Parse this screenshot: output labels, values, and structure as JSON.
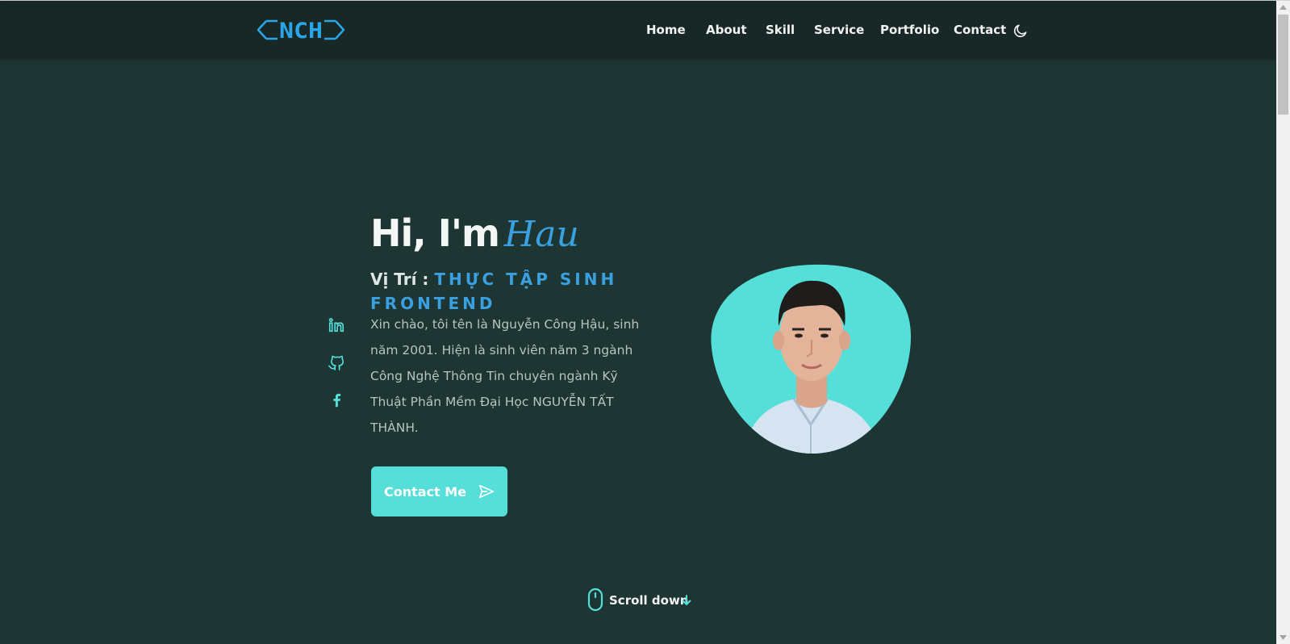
{
  "header": {
    "logo_text": "NCH",
    "nav": [
      {
        "label": "Home"
      },
      {
        "label": "About"
      },
      {
        "label": "Skill"
      },
      {
        "label": "Service"
      },
      {
        "label": "Portfolio"
      },
      {
        "label": "Contact"
      }
    ],
    "theme_toggle_icon": "moon-icon"
  },
  "social": [
    {
      "icon": "linkedin-icon"
    },
    {
      "icon": "github-icon"
    },
    {
      "icon": "facebook-icon"
    }
  ],
  "hero": {
    "greeting": "Hi, I'm",
    "name": "Hau",
    "role_label": "Vị Trí :",
    "role_value": "THỰC TẬP SINH FRONTEND",
    "intro": "Xin chào, tôi tên là Nguyễn Công Hậu, sinh năm 2001. Hiện là sinh viên năm 3 ngành Công Nghệ Thông Tin chuyên ngành Kỹ Thuật Phần Mềm Đại Học NGUYỄN TẤT THÀNH.",
    "contact_button": "Contact Me",
    "contact_icon": "send-icon"
  },
  "scroll": {
    "label": "Scroll down",
    "mouse_icon": "mouse-icon",
    "arrow_icon": "arrow-down-icon"
  },
  "colors": {
    "background": "#1d3533",
    "header": "#182826",
    "accent": "#55dfd8",
    "name_blue": "#3aa0e0"
  }
}
